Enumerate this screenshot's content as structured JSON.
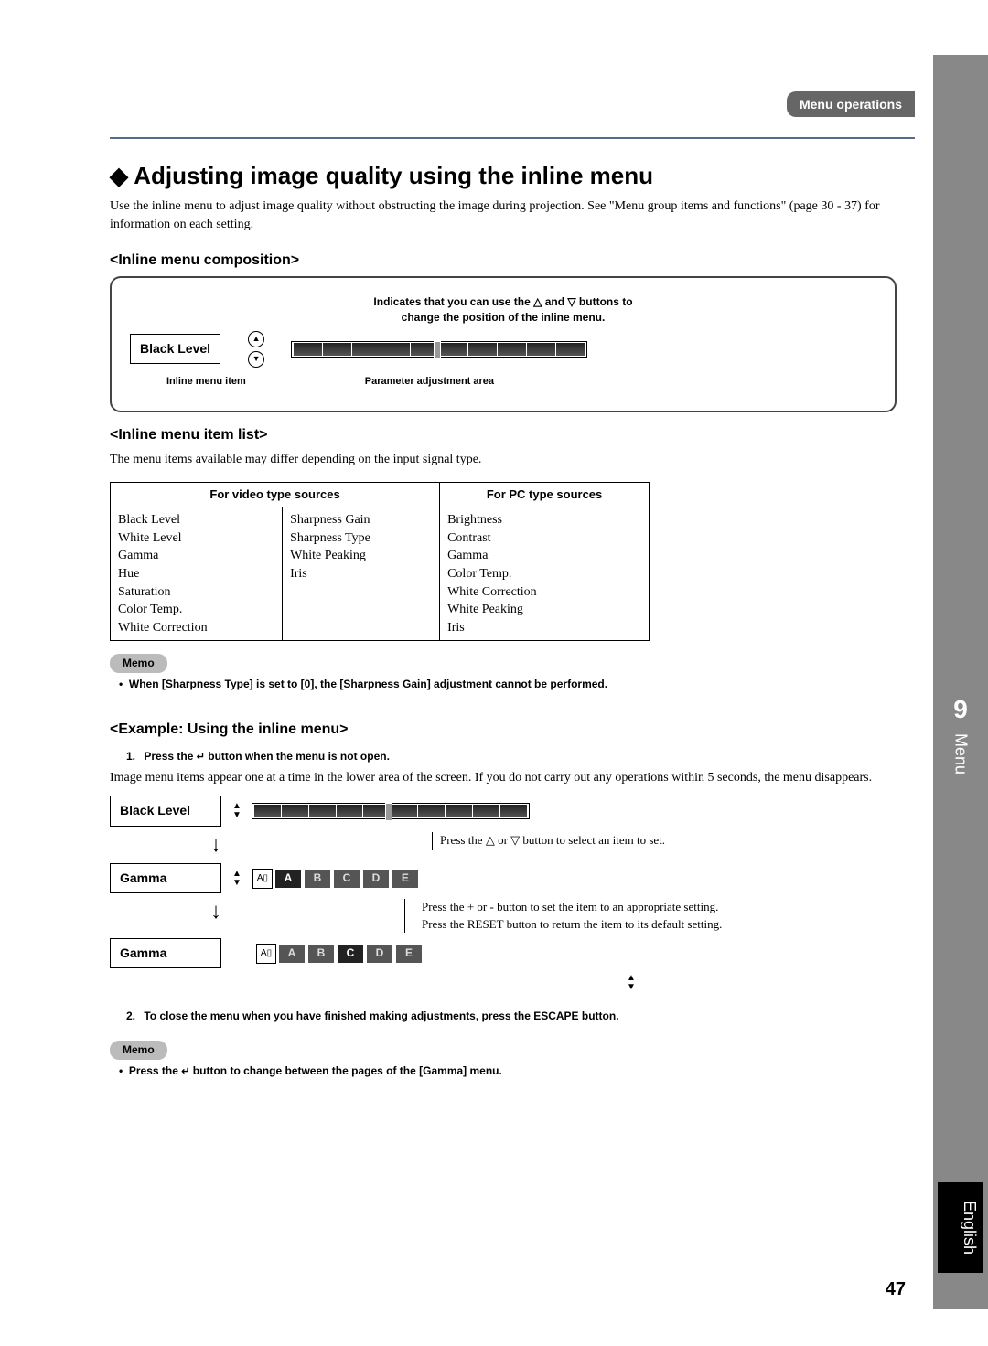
{
  "header": {
    "category": "Menu operations"
  },
  "title": "Adjusting image quality using the inline menu",
  "intro": "Use the inline menu to adjust image quality without obstructing the image during projection. See \"Menu group items and functions\" (page 30 - 37) for information on each setting.",
  "section_composition": {
    "heading": "<Inline menu composition>",
    "caption_line1": "Indicates that you can use the △ and ▽ buttons to",
    "caption_line2": "change the position of the inline menu.",
    "item_label": "Black Level",
    "label_left": "Inline menu item",
    "label_right": "Parameter adjustment area"
  },
  "section_list": {
    "heading": "<Inline menu item list>",
    "intro": "The menu items available may differ depending on the input signal type.",
    "th_video": "For video type sources",
    "th_pc": "For PC type sources",
    "video_col1": [
      "Black Level",
      "White Level",
      "Gamma",
      "Hue",
      "Saturation",
      "Color Temp.",
      "White Correction"
    ],
    "video_col2": [
      "Sharpness Gain",
      "Sharpness Type",
      "White Peaking",
      "Iris"
    ],
    "pc_col": [
      "Brightness",
      "Contrast",
      "Gamma",
      "Color Temp.",
      "White Correction",
      "White Peaking",
      "Iris"
    ]
  },
  "memo1": {
    "label": "Memo",
    "text": "When [Sharpness Type] is set to [0], the [Sharpness Gain] adjustment cannot be performed."
  },
  "section_example": {
    "heading": "<Example: Using the inline menu>",
    "step1_label": "1.",
    "step1_text_a": "Press the ",
    "step1_text_b": " button when the menu is not open.",
    "step1_body": "Image menu items appear one at a time in the lower area of the screen. If you do not carry out any operations within 5 seconds, the menu disappears.",
    "row1_item": "Black Level",
    "row1_note": "Press the △ or ▽ button to select an item to set.",
    "row2_item": "Gamma",
    "row2_note1": "Press the + or - button to set the item to an appropriate setting.",
    "row2_note2": "Press the RESET button to return the item to its default setting.",
    "row3_item": "Gamma",
    "gamma_labels": [
      "A",
      "B",
      "C",
      "D",
      "E"
    ],
    "step2_label": "2.",
    "step2_text": "To close the menu when you have finished making adjustments, press the ESCAPE button."
  },
  "memo2": {
    "label": "Memo",
    "text_a": "Press the ",
    "text_b": " button to change between the pages of the [Gamma] menu."
  },
  "side": {
    "chapter_num": "9",
    "chapter_label": "Menu",
    "language": "English"
  },
  "page_number": "47"
}
